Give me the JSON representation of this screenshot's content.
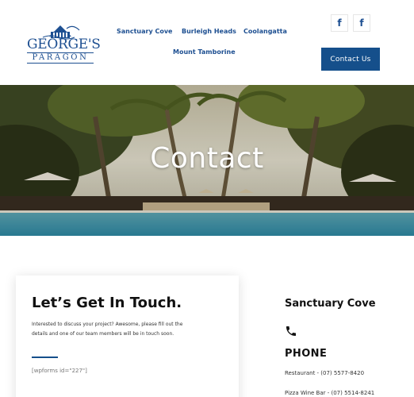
{
  "logo": {
    "line1": "GEORGE'S",
    "line2": "PARAGON"
  },
  "nav": {
    "items": [
      "Sanctuary Cove",
      "Burleigh Heads",
      "Coolangatta",
      "Mount Tamborine"
    ]
  },
  "social": {
    "icon1": "facebook-icon",
    "icon2": "facebook-icon",
    "glyph": "f"
  },
  "header": {
    "cta_label": "Contact Us"
  },
  "hero": {
    "title": "Contact"
  },
  "contact_card": {
    "title": "Let’s Get In Touch.",
    "description": "Interested to discuss your project? Awesome, please fill out the details and one of our team members will be in touch soon.",
    "shortcode": "[wpforms id=\"227\"]"
  },
  "location": {
    "name": "Sanctuary Cove",
    "phone_icon": "phone-icon",
    "phone_heading": "PHONE",
    "phones": [
      "Restaurant - (07) 5577-8420",
      "Pizza Wine Bar - (07) 5514-8241"
    ]
  },
  "colors": {
    "brand": "#154f8b",
    "nav_text": "#1d4f91"
  }
}
